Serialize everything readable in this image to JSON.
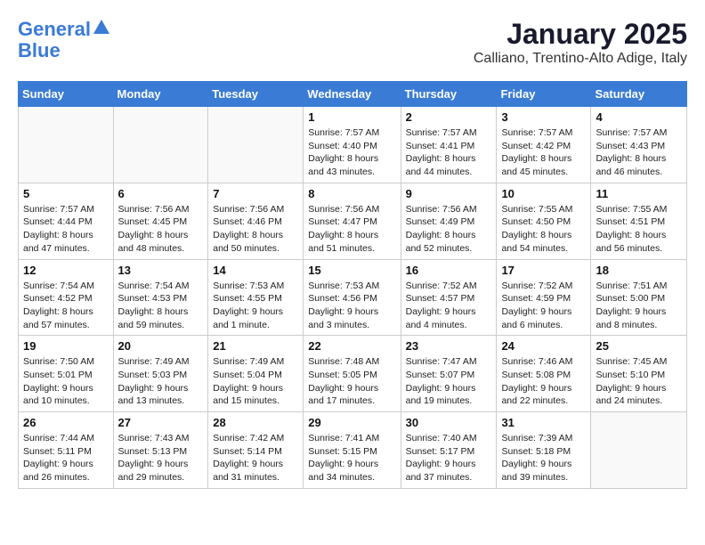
{
  "header": {
    "logo_line1": "General",
    "logo_line2": "Blue",
    "title": "January 2025",
    "subtitle": "Calliano, Trentino-Alto Adige, Italy"
  },
  "calendar": {
    "days_of_week": [
      "Sunday",
      "Monday",
      "Tuesday",
      "Wednesday",
      "Thursday",
      "Friday",
      "Saturday"
    ],
    "weeks": [
      [
        {
          "day": "",
          "info": ""
        },
        {
          "day": "",
          "info": ""
        },
        {
          "day": "",
          "info": ""
        },
        {
          "day": "1",
          "info": "Sunrise: 7:57 AM\nSunset: 4:40 PM\nDaylight: 8 hours\nand 43 minutes."
        },
        {
          "day": "2",
          "info": "Sunrise: 7:57 AM\nSunset: 4:41 PM\nDaylight: 8 hours\nand 44 minutes."
        },
        {
          "day": "3",
          "info": "Sunrise: 7:57 AM\nSunset: 4:42 PM\nDaylight: 8 hours\nand 45 minutes."
        },
        {
          "day": "4",
          "info": "Sunrise: 7:57 AM\nSunset: 4:43 PM\nDaylight: 8 hours\nand 46 minutes."
        }
      ],
      [
        {
          "day": "5",
          "info": "Sunrise: 7:57 AM\nSunset: 4:44 PM\nDaylight: 8 hours\nand 47 minutes."
        },
        {
          "day": "6",
          "info": "Sunrise: 7:56 AM\nSunset: 4:45 PM\nDaylight: 8 hours\nand 48 minutes."
        },
        {
          "day": "7",
          "info": "Sunrise: 7:56 AM\nSunset: 4:46 PM\nDaylight: 8 hours\nand 50 minutes."
        },
        {
          "day": "8",
          "info": "Sunrise: 7:56 AM\nSunset: 4:47 PM\nDaylight: 8 hours\nand 51 minutes."
        },
        {
          "day": "9",
          "info": "Sunrise: 7:56 AM\nSunset: 4:49 PM\nDaylight: 8 hours\nand 52 minutes."
        },
        {
          "day": "10",
          "info": "Sunrise: 7:55 AM\nSunset: 4:50 PM\nDaylight: 8 hours\nand 54 minutes."
        },
        {
          "day": "11",
          "info": "Sunrise: 7:55 AM\nSunset: 4:51 PM\nDaylight: 8 hours\nand 56 minutes."
        }
      ],
      [
        {
          "day": "12",
          "info": "Sunrise: 7:54 AM\nSunset: 4:52 PM\nDaylight: 8 hours\nand 57 minutes."
        },
        {
          "day": "13",
          "info": "Sunrise: 7:54 AM\nSunset: 4:53 PM\nDaylight: 8 hours\nand 59 minutes."
        },
        {
          "day": "14",
          "info": "Sunrise: 7:53 AM\nSunset: 4:55 PM\nDaylight: 9 hours\nand 1 minute."
        },
        {
          "day": "15",
          "info": "Sunrise: 7:53 AM\nSunset: 4:56 PM\nDaylight: 9 hours\nand 3 minutes."
        },
        {
          "day": "16",
          "info": "Sunrise: 7:52 AM\nSunset: 4:57 PM\nDaylight: 9 hours\nand 4 minutes."
        },
        {
          "day": "17",
          "info": "Sunrise: 7:52 AM\nSunset: 4:59 PM\nDaylight: 9 hours\nand 6 minutes."
        },
        {
          "day": "18",
          "info": "Sunrise: 7:51 AM\nSunset: 5:00 PM\nDaylight: 9 hours\nand 8 minutes."
        }
      ],
      [
        {
          "day": "19",
          "info": "Sunrise: 7:50 AM\nSunset: 5:01 PM\nDaylight: 9 hours\nand 10 minutes."
        },
        {
          "day": "20",
          "info": "Sunrise: 7:49 AM\nSunset: 5:03 PM\nDaylight: 9 hours\nand 13 minutes."
        },
        {
          "day": "21",
          "info": "Sunrise: 7:49 AM\nSunset: 5:04 PM\nDaylight: 9 hours\nand 15 minutes."
        },
        {
          "day": "22",
          "info": "Sunrise: 7:48 AM\nSunset: 5:05 PM\nDaylight: 9 hours\nand 17 minutes."
        },
        {
          "day": "23",
          "info": "Sunrise: 7:47 AM\nSunset: 5:07 PM\nDaylight: 9 hours\nand 19 minutes."
        },
        {
          "day": "24",
          "info": "Sunrise: 7:46 AM\nSunset: 5:08 PM\nDaylight: 9 hours\nand 22 minutes."
        },
        {
          "day": "25",
          "info": "Sunrise: 7:45 AM\nSunset: 5:10 PM\nDaylight: 9 hours\nand 24 minutes."
        }
      ],
      [
        {
          "day": "26",
          "info": "Sunrise: 7:44 AM\nSunset: 5:11 PM\nDaylight: 9 hours\nand 26 minutes."
        },
        {
          "day": "27",
          "info": "Sunrise: 7:43 AM\nSunset: 5:13 PM\nDaylight: 9 hours\nand 29 minutes."
        },
        {
          "day": "28",
          "info": "Sunrise: 7:42 AM\nSunset: 5:14 PM\nDaylight: 9 hours\nand 31 minutes."
        },
        {
          "day": "29",
          "info": "Sunrise: 7:41 AM\nSunset: 5:15 PM\nDaylight: 9 hours\nand 34 minutes."
        },
        {
          "day": "30",
          "info": "Sunrise: 7:40 AM\nSunset: 5:17 PM\nDaylight: 9 hours\nand 37 minutes."
        },
        {
          "day": "31",
          "info": "Sunrise: 7:39 AM\nSunset: 5:18 PM\nDaylight: 9 hours\nand 39 minutes."
        },
        {
          "day": "",
          "info": ""
        }
      ]
    ]
  }
}
